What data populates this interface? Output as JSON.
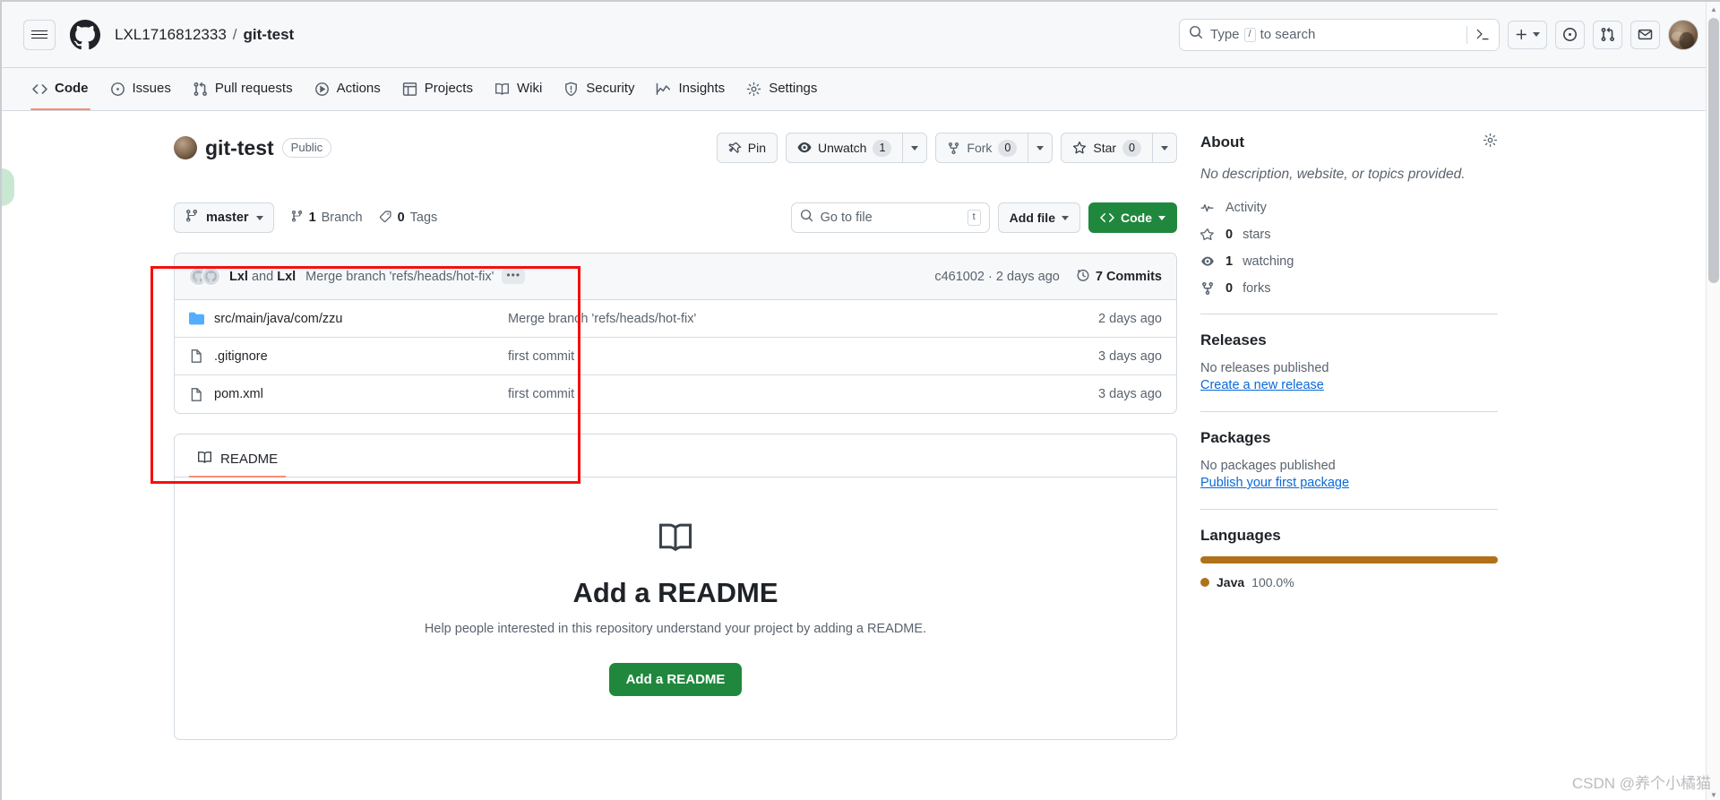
{
  "header": {
    "hamburger_icon": "hamburger-menu-icon",
    "logo_icon": "github-mark-icon",
    "owner": "LXL1716812333",
    "separator": "/",
    "repo": "git-test",
    "search": {
      "icon": "search-icon",
      "placeholder_before": "Type",
      "slash_key": "/",
      "placeholder_after": "to search",
      "terminal_icon": "command-palette-icon"
    },
    "create_new": {
      "icon": "plus-icon",
      "caret": "chevron-down-icon"
    },
    "issues_icon": "issue-opened-icon",
    "pull_requests_icon": "git-pull-request-icon",
    "inbox_icon": "inbox-icon",
    "avatar": "user-avatar"
  },
  "nav": {
    "items": [
      {
        "label": "Code",
        "icon": "code-icon",
        "active": true
      },
      {
        "label": "Issues",
        "icon": "issue-opened-icon",
        "active": false
      },
      {
        "label": "Pull requests",
        "icon": "git-pull-request-icon",
        "active": false
      },
      {
        "label": "Actions",
        "icon": "play-icon",
        "active": false
      },
      {
        "label": "Projects",
        "icon": "table-icon",
        "active": false
      },
      {
        "label": "Wiki",
        "icon": "book-icon",
        "active": false
      },
      {
        "label": "Security",
        "icon": "shield-icon",
        "active": false
      },
      {
        "label": "Insights",
        "icon": "graph-icon",
        "active": false
      },
      {
        "label": "Settings",
        "icon": "gear-icon",
        "active": false
      }
    ]
  },
  "repo": {
    "avatar": "owner-avatar",
    "name": "git-test",
    "visibility": "Public",
    "actions": {
      "pin": {
        "label": "Pin",
        "icon": "pin-icon"
      },
      "unwatch": {
        "label": "Unwatch",
        "count": "1",
        "icon": "eye-icon"
      },
      "fork": {
        "label": "Fork",
        "count": "0",
        "icon": "repo-forked-icon"
      },
      "star": {
        "label": "Star",
        "count": "0",
        "icon": "star-icon"
      }
    }
  },
  "toolbar": {
    "branch": {
      "label": "master",
      "icon": "git-branch-icon"
    },
    "branch_count": {
      "num": "1",
      "label": "Branch",
      "icon": "git-branch-icon"
    },
    "tag_count": {
      "num": "0",
      "label": "Tags",
      "icon": "tag-icon"
    },
    "go_to_file": {
      "placeholder": "Go to file",
      "key_hint": "t",
      "icon": "search-icon"
    },
    "add_file": {
      "label": "Add file",
      "caret": "chevron-down-icon"
    },
    "code": {
      "label": "Code",
      "icon": "code-icon",
      "caret": "chevron-down-icon",
      "color": "#1f883d"
    }
  },
  "commit_bar": {
    "author_1": "Lxl",
    "conjunction": "and",
    "author_2": "Lxl",
    "message": "Merge branch 'refs/heads/hot-fix'",
    "expand_icon": "ellipsis-icon",
    "sha": "c461002",
    "sha_separator": "·",
    "relative_time": "2 days ago",
    "commits_count": "7 Commits",
    "history_icon": "history-icon"
  },
  "files": [
    {
      "name": "src/main/java/com/zzu",
      "type": "folder",
      "icon": "folder-icon",
      "message": "Merge branch 'refs/heads/hot-fix'",
      "time": "2 days ago"
    },
    {
      "name": ".gitignore",
      "type": "file",
      "icon": "file-icon",
      "message": "first commit",
      "time": "3 days ago"
    },
    {
      "name": "pom.xml",
      "type": "file",
      "icon": "file-icon",
      "message": "first commit",
      "time": "3 days ago"
    }
  ],
  "readme": {
    "tab_label": "README",
    "tab_icon": "book-icon",
    "empty_icon": "book-open-icon",
    "title": "Add a README",
    "description": "Help people interested in this repository understand your project by adding a README.",
    "button_label": "Add a README"
  },
  "sidebar": {
    "about": {
      "title": "About",
      "gear_icon": "gear-icon",
      "description": "No description, website, or topics provided.",
      "rows": [
        {
          "label": "Activity",
          "icon": "pulse-icon",
          "value": ""
        },
        {
          "label": "stars",
          "icon": "star-icon",
          "value": "0"
        },
        {
          "label": "watching",
          "icon": "eye-icon",
          "value": "1"
        },
        {
          "label": "forks",
          "icon": "repo-forked-icon",
          "value": "0"
        }
      ]
    },
    "releases": {
      "title": "Releases",
      "empty": "No releases published",
      "link": "Create a new release"
    },
    "packages": {
      "title": "Packages",
      "empty": "No packages published",
      "link": "Publish your first package"
    },
    "languages": {
      "title": "Languages",
      "items": [
        {
          "name": "Java",
          "percent": "100.0%",
          "color": "#b07219",
          "width": 100
        }
      ]
    }
  },
  "watermark": "CSDN @养个小橘猫",
  "annotation": {
    "color": "#f60f0f",
    "shape": "rectangle-highlight"
  },
  "scrollbar": {
    "up_icon": "chevron-up-icon",
    "down_icon": "chevron-down-icon"
  }
}
